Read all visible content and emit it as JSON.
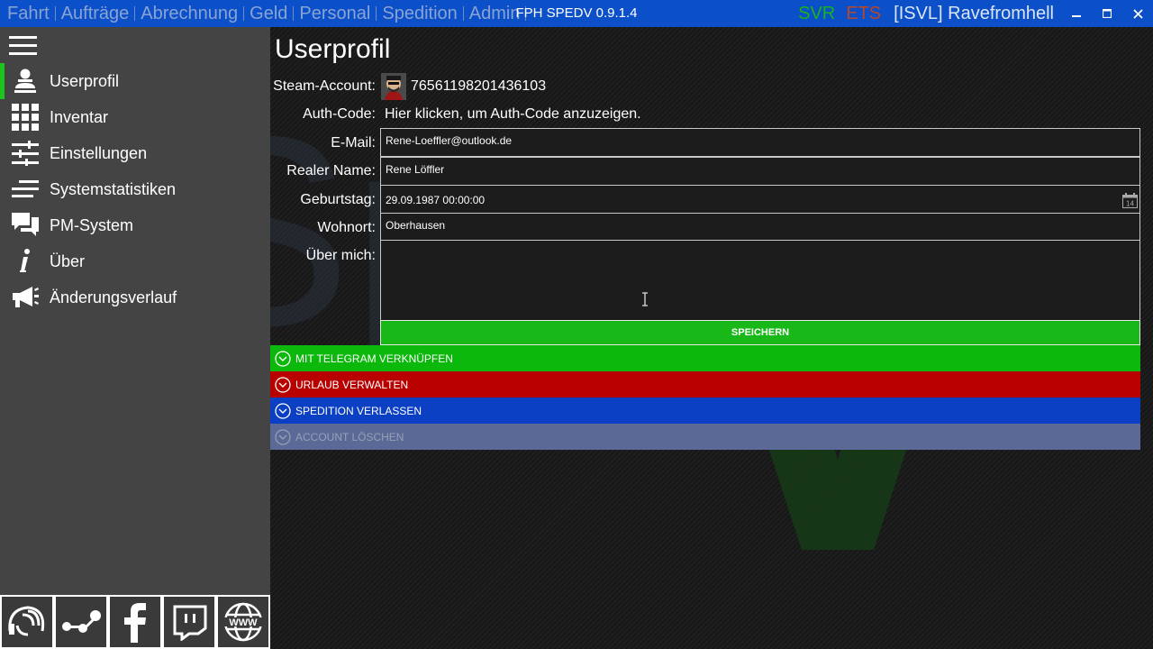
{
  "titlebar": {
    "menu": [
      "Fahrt",
      "Aufträge",
      "Abrechnung",
      "Geld",
      "Personal",
      "Spedition",
      "Admin"
    ],
    "app_title": "FPH SPEDV 0.9.1.4",
    "game_svr": "SVR",
    "game_ets": "ETS",
    "user": "[ISVL] Ravefromhell",
    "buttons": {
      "minimize": "–",
      "maximize": "▫",
      "close": "✕"
    }
  },
  "sidebar": {
    "items": [
      {
        "label": "Userprofil",
        "icon": "user-icon",
        "active": true
      },
      {
        "label": "Inventar",
        "icon": "grid-icon",
        "active": false
      },
      {
        "label": "Einstellungen",
        "icon": "sliders-icon",
        "active": false
      },
      {
        "label": "Systemstatistiken",
        "icon": "lines-icon",
        "active": false
      },
      {
        "label": "PM-System",
        "icon": "chat-icon",
        "active": false
      },
      {
        "label": "Über",
        "icon": "info-icon",
        "active": false
      },
      {
        "label": "Änderungsverlauf",
        "icon": "megaphone-icon",
        "active": false
      }
    ],
    "footer_icons": [
      "teamspeak-icon",
      "steam-icon",
      "facebook-icon",
      "twitch-icon",
      "www-icon"
    ]
  },
  "main": {
    "title": "Userprofil",
    "labels": {
      "steam": "Steam-Account:",
      "auth": "Auth-Code:",
      "email": "E-Mail:",
      "name": "Realer Name:",
      "birthday": "Geburtstag:",
      "city": "Wohnort:",
      "about": "Über mich:"
    },
    "values": {
      "steam_id": "76561198201436103",
      "auth_link": "Hier klicken, um Auth-Code anzuzeigen.",
      "email": "Rene-Loeffler@outlook.de",
      "name": "Rene Löffler",
      "birthday": "29.09.1987 00:00:00",
      "city": "Oberhausen",
      "calendar_day": "14"
    },
    "save_label": "SPEICHERN",
    "expanders": {
      "telegram": "MIT TELEGRAM VERKNÜPFEN",
      "urlaub": "URLAUB VERWALTEN",
      "spedition": "SPEDITION VERLASSEN",
      "delete": "ACCOUNT LÖSCHEN"
    }
  },
  "colors": {
    "titlebar": "#0b50c8",
    "sidebar": "#444444",
    "accent_green": "#17b817",
    "danger_red": "#b90000",
    "blue": "#0b3fc4",
    "disabled": "#5a6996"
  }
}
